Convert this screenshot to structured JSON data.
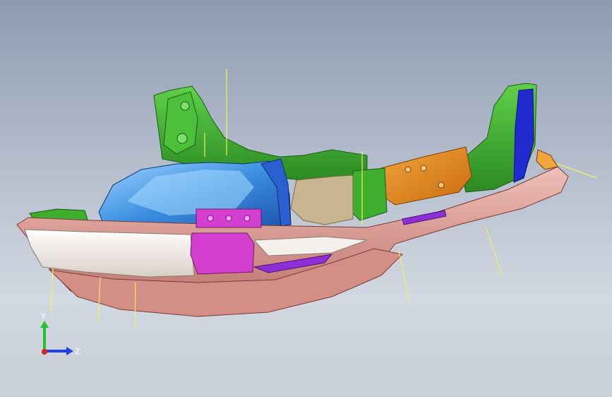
{
  "viewport": {
    "background_top": "#8e9bb0",
    "background_bottom": "#d2d8e1"
  },
  "model": {
    "description_icon": "cad-assembly-icon",
    "colors": {
      "underbody": "#e3a39b",
      "green_panel": "#3fae2f",
      "blue_tunnel": "#3b8fe0",
      "magenta_bracket": "#d43fd0",
      "orange_panel": "#e3891c",
      "dark_blue_rail": "#1f2bd1",
      "yellow_leader": "#f0f060",
      "white_cap": "#f4f1ec",
      "tan_panel": "#c8b691",
      "purple_strip": "#8e2fd6"
    }
  },
  "triad": {
    "y_label": "Y",
    "z_label": "Z",
    "colors": {
      "y": "#27c12f",
      "z": "#2140e8",
      "x": "#e02020"
    }
  }
}
